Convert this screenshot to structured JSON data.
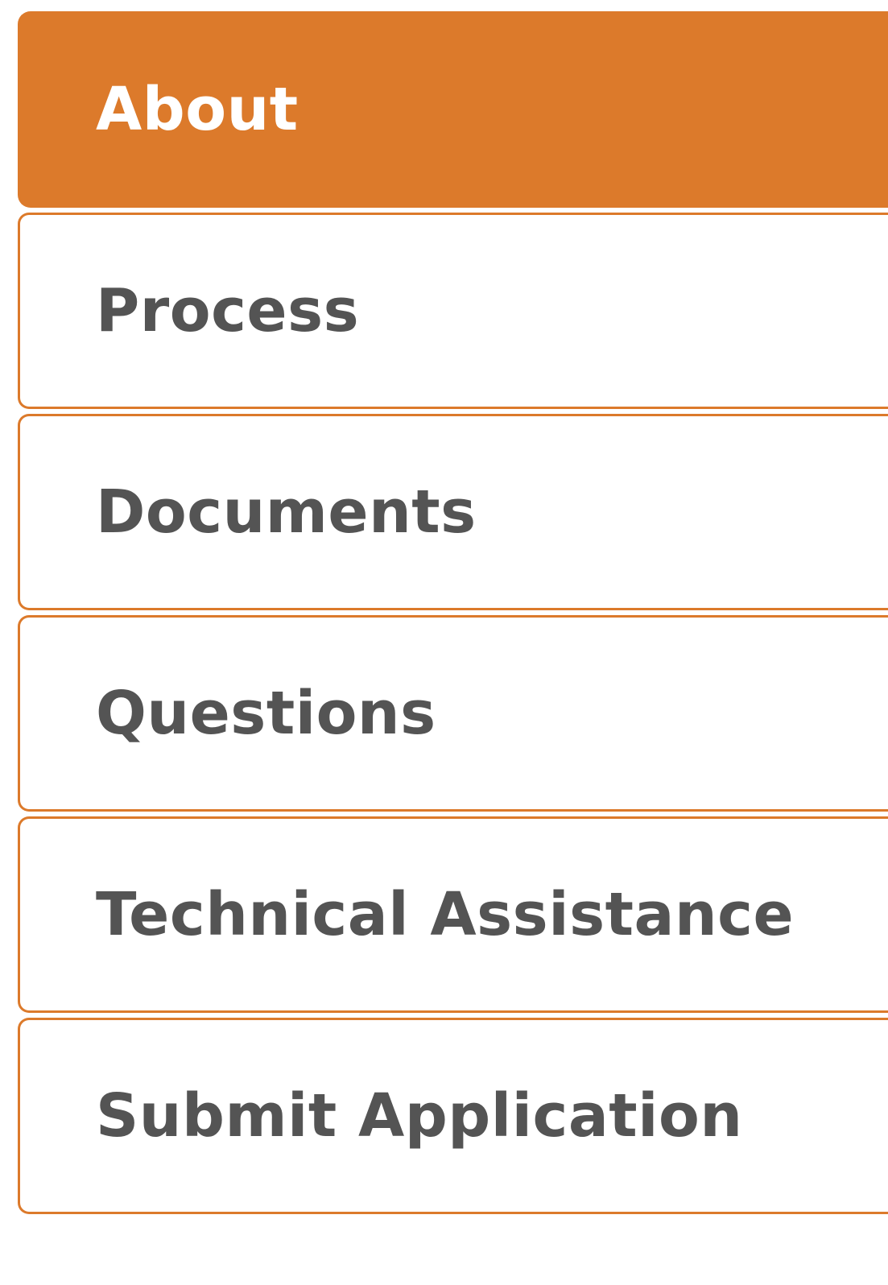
{
  "accent_color": "#dc7a2b",
  "text_color": "#545454",
  "active_text_color": "#ffffff",
  "nav": {
    "active_index": 0,
    "items": [
      {
        "label": "About"
      },
      {
        "label": "Process"
      },
      {
        "label": "Documents"
      },
      {
        "label": "Questions"
      },
      {
        "label": "Technical Assistance"
      },
      {
        "label": "Submit Application"
      }
    ]
  }
}
